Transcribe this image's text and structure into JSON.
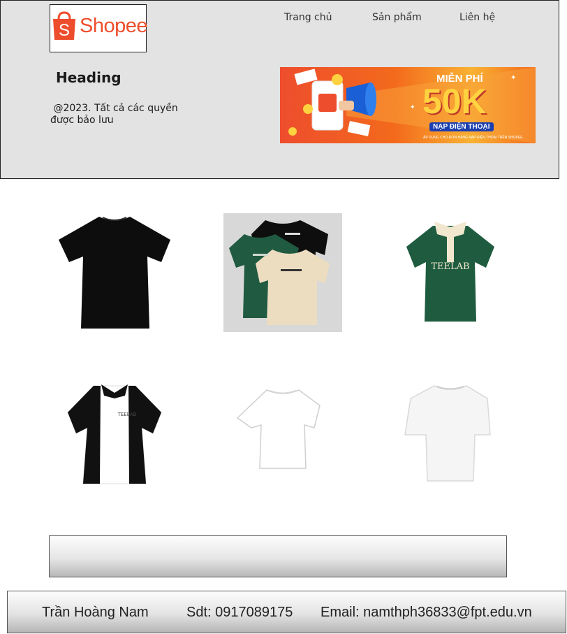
{
  "logo": {
    "brand_text": "Shopee",
    "bag_letter": "S",
    "brand_color": "#ee4d2d"
  },
  "nav": {
    "items": [
      "Trang chủ",
      "Sản phẩm",
      "Liên hệ"
    ]
  },
  "hero": {
    "heading": "Heading",
    "copyright": " @2023. Tất cả các quyền\nđược bảo lưu"
  },
  "banner": {
    "free_label": "MIỄN PHÍ",
    "amount": "50K",
    "tag": "NẠP ĐIỆN THOẠI",
    "note": "ÁP DỤNG CHO ĐƠN HÀNG NẠP ĐIỆN THOẠI TRÊN SHOPEE",
    "colors": {
      "orange": "#ee4d2d",
      "yellow": "#ffd23f",
      "blue": "#1b3fb0"
    }
  },
  "products": [
    {
      "name": "black-tshirt",
      "color": "#0d0d0d"
    },
    {
      "name": "tshirt-bundle",
      "color": "#1f5a41"
    },
    {
      "name": "green-polo",
      "color": "#1f5c3f",
      "print": "TEELAB"
    },
    {
      "name": "black-white-polo",
      "color": "#111111",
      "print": "TEELAB"
    },
    {
      "name": "white-tshirt",
      "color": "#ffffff"
    },
    {
      "name": "white-oversize-tshirt",
      "color": "#ffffff"
    }
  ],
  "footer": {
    "name": "Trần Hoàng Nam",
    "phone": "Sdt: 0917089175",
    "email": "Email: namthph36833@fpt.edu.vn"
  }
}
